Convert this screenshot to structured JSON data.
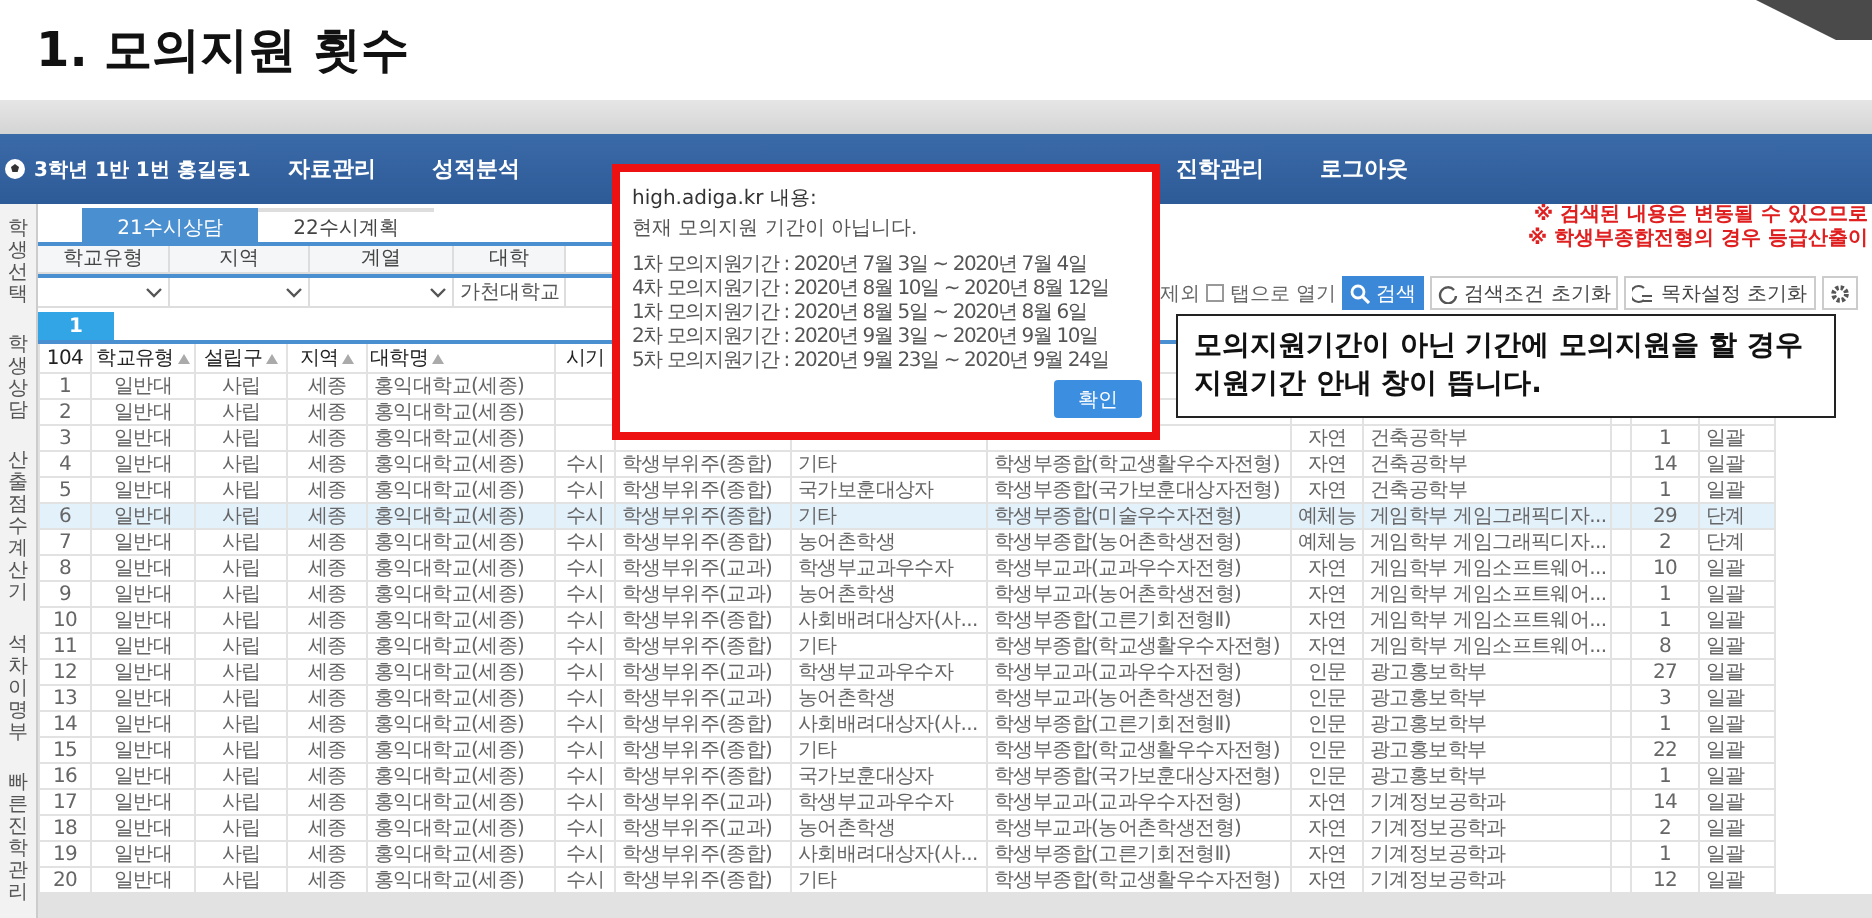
{
  "slide": {
    "title": "1. 모의지원 횟수"
  },
  "nav": {
    "user": "3학년 1반 1번 홍길동1",
    "left_items": [
      "자료관리",
      "성적분석"
    ],
    "right_items": [
      "진학관리",
      "로그아웃"
    ]
  },
  "sidebar": {
    "items": [
      "학생선택",
      "학생상담",
      "산출점수계산기",
      "석차이명부",
      "빠른진학관리"
    ]
  },
  "tabs": [
    {
      "label": "21수시상담",
      "selected": true
    },
    {
      "label": "22수시계획",
      "selected": false
    }
  ],
  "filters": [
    {
      "label": "학교유형"
    },
    {
      "label": "지역"
    },
    {
      "label": "계열"
    },
    {
      "label": "대학",
      "value": "가천대학교"
    }
  ],
  "notices": [
    "※ 검색된 내용은 변동될 수 있으므로",
    "※ 학생부종합전형의 경우 등급산출이"
  ],
  "toolbar": {
    "fragment": "제외",
    "open_in_tab": {
      "label": "탭으로 열기",
      "checked": false
    },
    "buttons": [
      {
        "kind": "search",
        "label": "검색"
      },
      {
        "kind": "reset",
        "label": "검색조건 초기화"
      },
      {
        "kind": "columns",
        "label": "목차설정 초기화"
      },
      {
        "kind": "settings"
      }
    ]
  },
  "pagination": [
    {
      "label": "1",
      "selected": true
    }
  ],
  "table": {
    "columns": [
      {
        "label": "104",
        "sortable": false
      },
      {
        "label": "학교유형",
        "sortable": true
      },
      {
        "label": "설립구",
        "sortable": true
      },
      {
        "label": "지역",
        "sortable": true
      },
      {
        "label": "대학명",
        "sortable": true
      },
      {
        "label": "시기",
        "sortable": false
      }
    ],
    "rows": [
      {
        "selected": false,
        "cells": {
          "no": "1",
          "school_type": "일반대",
          "founding": "사립",
          "region": "세종",
          "university": "홍익대학교(세종)"
        }
      },
      {
        "selected": false,
        "cells": {
          "no": "2",
          "school_type": "일반대",
          "founding": "사립",
          "region": "세종",
          "university": "홍익대학교(세종)"
        }
      },
      {
        "selected": false,
        "cells": {
          "no": "3",
          "school_type": "일반대",
          "founding": "사립",
          "region": "세종",
          "university": "홍익대학교(세종)",
          "field": "자연",
          "unit": "건축공학부",
          "count": "1",
          "stage": "일괄"
        }
      },
      {
        "selected": false,
        "cells": {
          "no": "4",
          "school_type": "일반대",
          "founding": "사립",
          "region": "세종",
          "university": "홍익대학교(세종)",
          "period": "수시",
          "admission_category": "학생부위주(종합)",
          "admission_type": "기타",
          "admission_name": "학생부종합(학교생활우수자전형)",
          "field": "자연",
          "unit": "건축공학부",
          "count": "14",
          "stage": "일괄"
        }
      },
      {
        "selected": false,
        "cells": {
          "no": "5",
          "school_type": "일반대",
          "founding": "사립",
          "region": "세종",
          "university": "홍익대학교(세종)",
          "period": "수시",
          "admission_category": "학생부위주(종합)",
          "admission_type": "국가보훈대상자",
          "admission_name": "학생부종합(국가보훈대상자전형)",
          "field": "자연",
          "unit": "건축공학부",
          "count": "1",
          "stage": "일괄"
        }
      },
      {
        "selected": true,
        "cells": {
          "no": "6",
          "school_type": "일반대",
          "founding": "사립",
          "region": "세종",
          "university": "홍익대학교(세종)",
          "period": "수시",
          "admission_category": "학생부위주(종합)",
          "admission_type": "기타",
          "admission_name": "학생부종합(미술우수자전형)",
          "field": "예체능",
          "unit": "게임학부 게임그래픽디자...",
          "count": "29",
          "stage": "단계"
        }
      },
      {
        "selected": false,
        "cells": {
          "no": "7",
          "school_type": "일반대",
          "founding": "사립",
          "region": "세종",
          "university": "홍익대학교(세종)",
          "period": "수시",
          "admission_category": "학생부위주(종합)",
          "admission_type": "농어촌학생",
          "admission_name": "학생부종합(농어촌학생전형)",
          "field": "예체능",
          "unit": "게임학부 게임그래픽디자...",
          "count": "2",
          "stage": "단계"
        }
      },
      {
        "selected": false,
        "cells": {
          "no": "8",
          "school_type": "일반대",
          "founding": "사립",
          "region": "세종",
          "university": "홍익대학교(세종)",
          "period": "수시",
          "admission_category": "학생부위주(교과)",
          "admission_type": "학생부교과우수자",
          "admission_name": "학생부교과(교과우수자전형)",
          "field": "자연",
          "unit": "게임학부 게임소프트웨어...",
          "count": "10",
          "stage": "일괄"
        }
      },
      {
        "selected": false,
        "cells": {
          "no": "9",
          "school_type": "일반대",
          "founding": "사립",
          "region": "세종",
          "university": "홍익대학교(세종)",
          "period": "수시",
          "admission_category": "학생부위주(교과)",
          "admission_type": "농어촌학생",
          "admission_name": "학생부교과(농어촌학생전형)",
          "field": "자연",
          "unit": "게임학부 게임소프트웨어...",
          "count": "1",
          "stage": "일괄"
        }
      },
      {
        "selected": false,
        "cells": {
          "no": "10",
          "school_type": "일반대",
          "founding": "사립",
          "region": "세종",
          "university": "홍익대학교(세종)",
          "period": "수시",
          "admission_category": "학생부위주(종합)",
          "admission_type": "사회배려대상자(사...",
          "admission_name": "학생부종합(고른기회전형Ⅱ)",
          "field": "자연",
          "unit": "게임학부 게임소프트웨어...",
          "count": "1",
          "stage": "일괄"
        }
      },
      {
        "selected": false,
        "cells": {
          "no": "11",
          "school_type": "일반대",
          "founding": "사립",
          "region": "세종",
          "university": "홍익대학교(세종)",
          "period": "수시",
          "admission_category": "학생부위주(종합)",
          "admission_type": "기타",
          "admission_name": "학생부종합(학교생활우수자전형)",
          "field": "자연",
          "unit": "게임학부 게임소프트웨어...",
          "count": "8",
          "stage": "일괄"
        }
      },
      {
        "selected": false,
        "cells": {
          "no": "12",
          "school_type": "일반대",
          "founding": "사립",
          "region": "세종",
          "university": "홍익대학교(세종)",
          "period": "수시",
          "admission_category": "학생부위주(교과)",
          "admission_type": "학생부교과우수자",
          "admission_name": "학생부교과(교과우수자전형)",
          "field": "인문",
          "unit": "광고홍보학부",
          "count": "27",
          "stage": "일괄"
        }
      },
      {
        "selected": false,
        "cells": {
          "no": "13",
          "school_type": "일반대",
          "founding": "사립",
          "region": "세종",
          "university": "홍익대학교(세종)",
          "period": "수시",
          "admission_category": "학생부위주(교과)",
          "admission_type": "농어촌학생",
          "admission_name": "학생부교과(농어촌학생전형)",
          "field": "인문",
          "unit": "광고홍보학부",
          "count": "3",
          "stage": "일괄"
        }
      },
      {
        "selected": false,
        "cells": {
          "no": "14",
          "school_type": "일반대",
          "founding": "사립",
          "region": "세종",
          "university": "홍익대학교(세종)",
          "period": "수시",
          "admission_category": "학생부위주(종합)",
          "admission_type": "사회배려대상자(사...",
          "admission_name": "학생부종합(고른기회전형Ⅱ)",
          "field": "인문",
          "unit": "광고홍보학부",
          "count": "1",
          "stage": "일괄"
        }
      },
      {
        "selected": false,
        "cells": {
          "no": "15",
          "school_type": "일반대",
          "founding": "사립",
          "region": "세종",
          "university": "홍익대학교(세종)",
          "period": "수시",
          "admission_category": "학생부위주(종합)",
          "admission_type": "기타",
          "admission_name": "학생부종합(학교생활우수자전형)",
          "field": "인문",
          "unit": "광고홍보학부",
          "count": "22",
          "stage": "일괄"
        }
      },
      {
        "selected": false,
        "cells": {
          "no": "16",
          "school_type": "일반대",
          "founding": "사립",
          "region": "세종",
          "university": "홍익대학교(세종)",
          "period": "수시",
          "admission_category": "학생부위주(종합)",
          "admission_type": "국가보훈대상자",
          "admission_name": "학생부종합(국가보훈대상자전형)",
          "field": "인문",
          "unit": "광고홍보학부",
          "count": "1",
          "stage": "일괄"
        }
      },
      {
        "selected": false,
        "cells": {
          "no": "17",
          "school_type": "일반대",
          "founding": "사립",
          "region": "세종",
          "university": "홍익대학교(세종)",
          "period": "수시",
          "admission_category": "학생부위주(교과)",
          "admission_type": "학생부교과우수자",
          "admission_name": "학생부교과(교과우수자전형)",
          "field": "자연",
          "unit": "기계정보공학과",
          "count": "14",
          "stage": "일괄"
        }
      },
      {
        "selected": false,
        "cells": {
          "no": "18",
          "school_type": "일반대",
          "founding": "사립",
          "region": "세종",
          "university": "홍익대학교(세종)",
          "period": "수시",
          "admission_category": "학생부위주(교과)",
          "admission_type": "농어촌학생",
          "admission_name": "학생부교과(농어촌학생전형)",
          "field": "자연",
          "unit": "기계정보공학과",
          "count": "2",
          "stage": "일괄"
        }
      },
      {
        "selected": false,
        "cells": {
          "no": "19",
          "school_type": "일반대",
          "founding": "사립",
          "region": "세종",
          "university": "홍익대학교(세종)",
          "period": "수시",
          "admission_category": "학생부위주(종합)",
          "admission_type": "사회배려대상자(사...",
          "admission_name": "학생부종합(고른기회전형Ⅱ)",
          "field": "자연",
          "unit": "기계정보공학과",
          "count": "1",
          "stage": "일괄"
        }
      },
      {
        "selected": false,
        "cells": {
          "no": "20",
          "school_type": "일반대",
          "founding": "사립",
          "region": "세종",
          "university": "홍익대학교(세종)",
          "period": "수시",
          "admission_category": "학생부위주(종합)",
          "admission_type": "기타",
          "admission_name": "학생부종합(학교생활우수자전형)",
          "field": "자연",
          "unit": "기계정보공학과",
          "count": "12",
          "stage": "일괄"
        }
      }
    ]
  },
  "dialog": {
    "title": "high.adiga.kr 내용:",
    "message": "현재 모의지원 기간이 아닙니다.",
    "periods": [
      "1차 모의지원기간 : 2020년 7월 3일 ~ 2020년 7월 4일",
      "4차 모의지원기간 : 2020년 8월 10일 ~ 2020년 8월 12일",
      "1차 모의지원기간 : 2020년 8월 5일 ~ 2020년 8월 6일",
      "2차 모의지원기간 : 2020년 9월 3일 ~ 2020년 9월 10일",
      "5차 모의지원기간 : 2020년 9월 23일 ~ 2020년 9월 24일"
    ],
    "button": "확인"
  },
  "callout": {
    "lines": [
      "모의지원기간이 아닌 기간에 모의지원을 할 경우",
      "지원기간 안내 창이 뜹니다."
    ]
  }
}
